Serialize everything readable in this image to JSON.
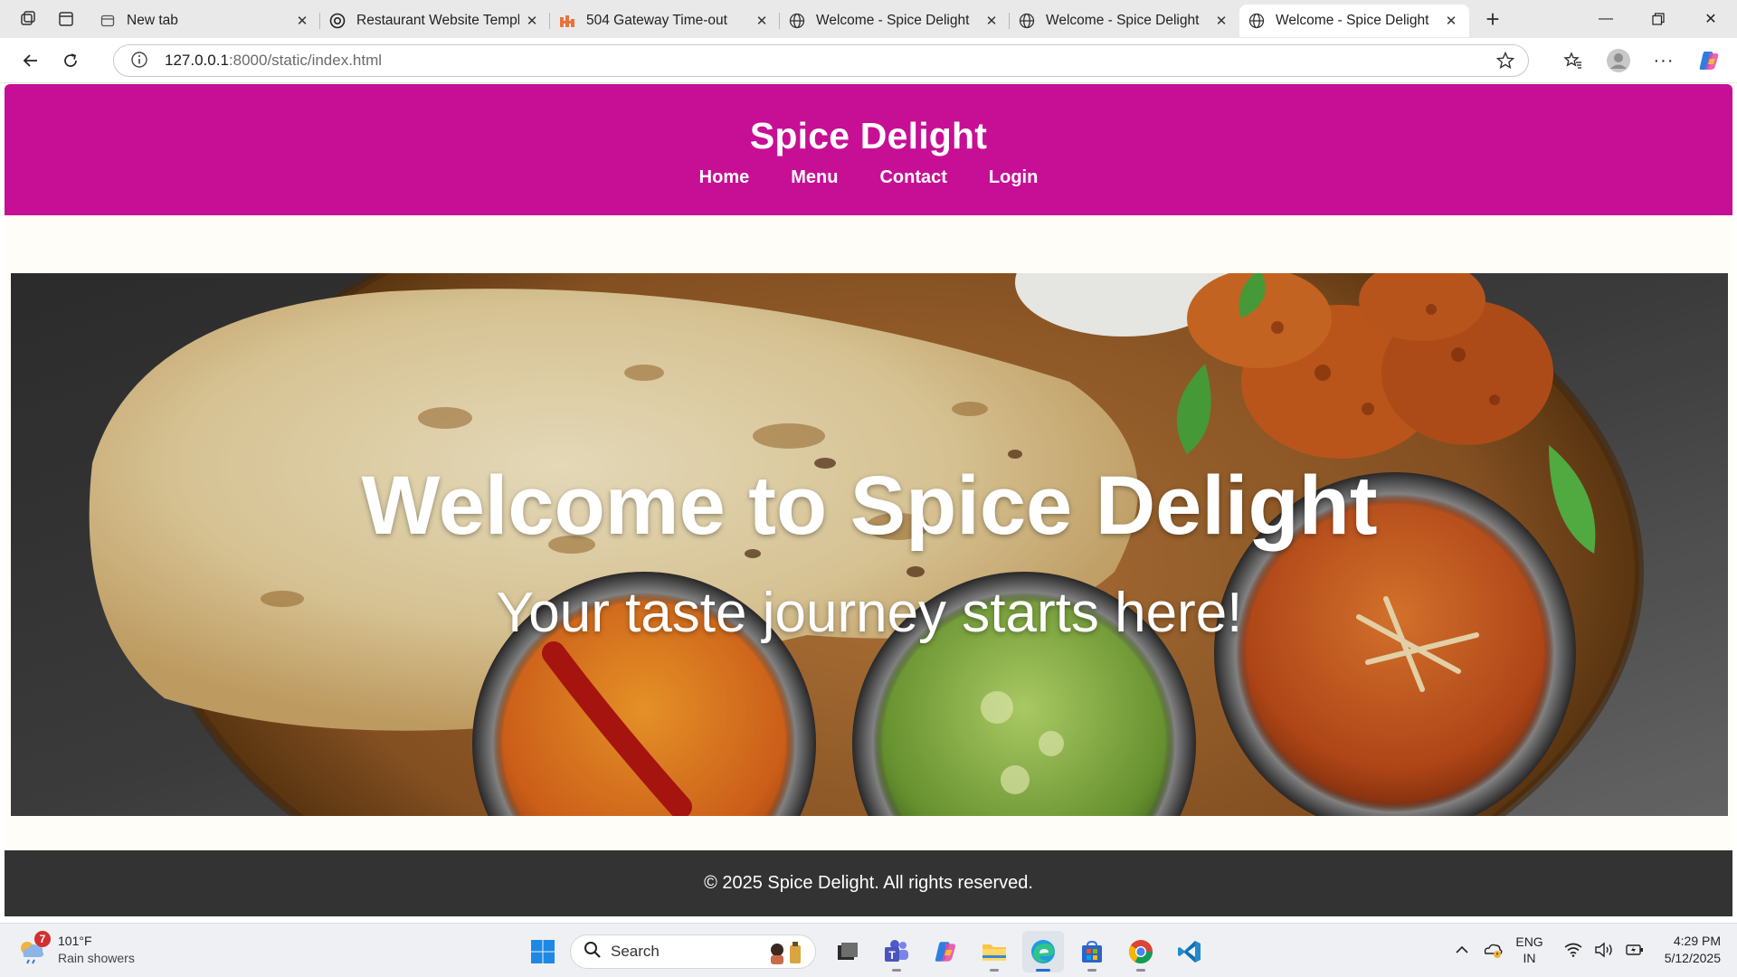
{
  "browser": {
    "tabs": [
      {
        "title": "New tab",
        "icon": "new-tab-page-icon",
        "active": false
      },
      {
        "title": "Restaurant Website Templa",
        "icon": "chatgpt-icon",
        "active": false
      },
      {
        "title": "504 Gateway Time-out",
        "icon": "hostinger-icon",
        "active": false
      },
      {
        "title": "Welcome - Spice Delight",
        "icon": "globe-icon",
        "active": false
      },
      {
        "title": "Welcome - Spice Delight",
        "icon": "globe-icon",
        "active": false
      },
      {
        "title": "Welcome - Spice Delight",
        "icon": "globe-icon",
        "active": true
      }
    ],
    "address": {
      "host": "127.0.0.1",
      "path": ":8000/static/index.html"
    }
  },
  "site": {
    "title": "Spice Delight",
    "nav": [
      "Home",
      "Menu",
      "Contact",
      "Login"
    ],
    "hero_title": "Welcome to Spice Delight",
    "hero_subtitle": "Your taste journey starts here!",
    "footer": "© 2025 Spice Delight. All rights reserved.",
    "colors": {
      "header": "#c70f95",
      "footer": "#333333",
      "background": "#fffdf7"
    }
  },
  "taskbar": {
    "weather": {
      "badge": "7",
      "temp": "101°F",
      "condition": "Rain showers"
    },
    "search_placeholder": "Search",
    "apps": [
      "file-explorer-folder",
      "teams",
      "copilot",
      "file-explorer",
      "edge",
      "store",
      "chrome",
      "vscode"
    ],
    "lang": {
      "line1": "ENG",
      "line2": "IN"
    },
    "clock": {
      "time": "4:29 PM",
      "date": "5/12/2025"
    }
  }
}
